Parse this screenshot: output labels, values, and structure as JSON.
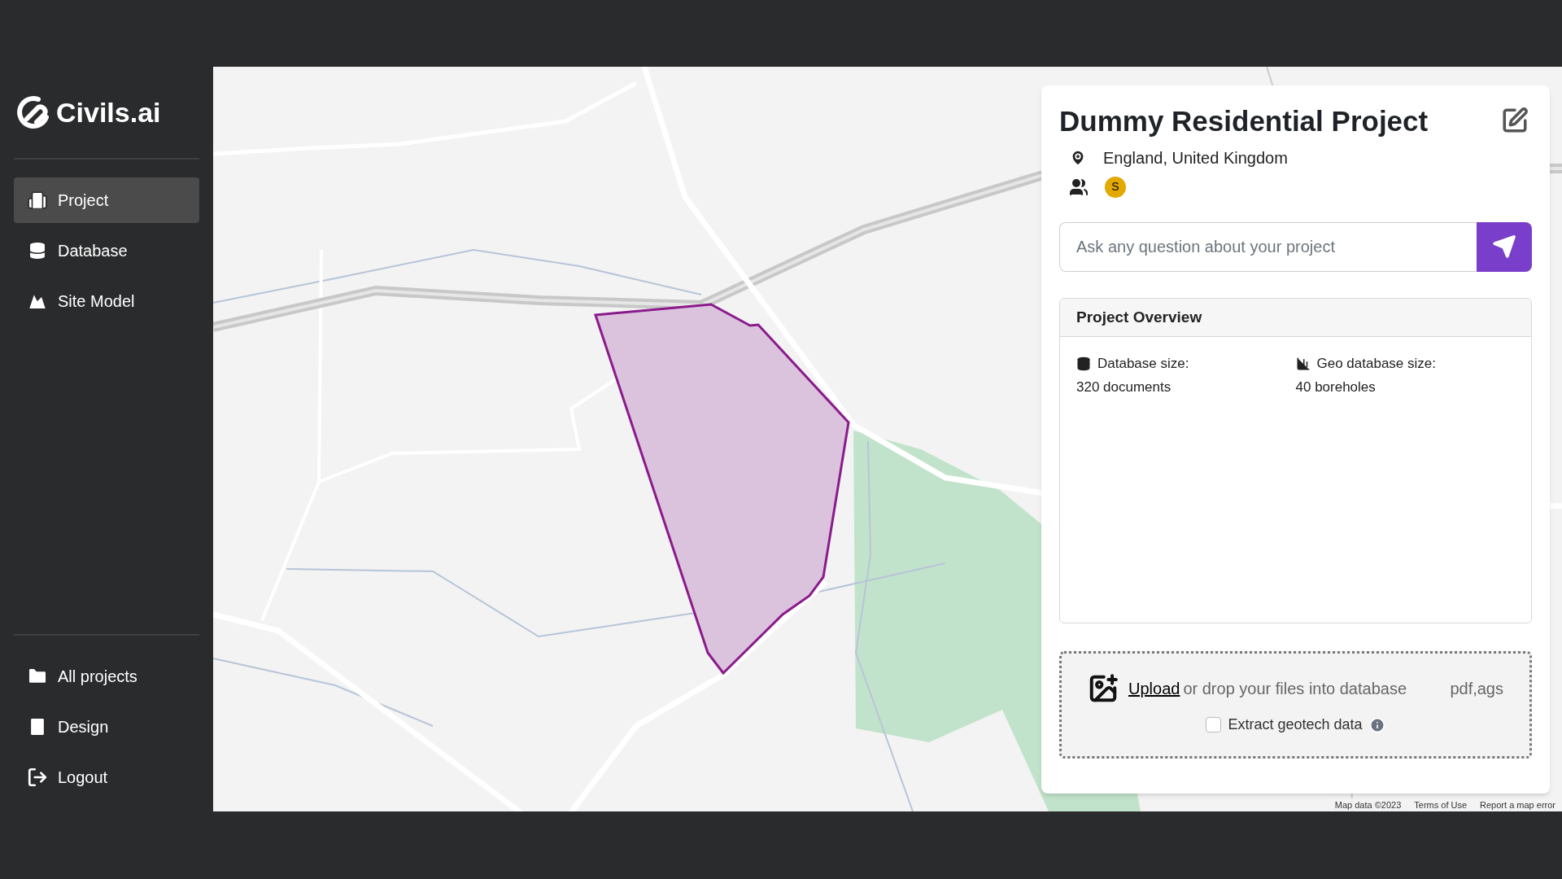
{
  "brand": {
    "name": "Civils.ai"
  },
  "sidebar": {
    "items": [
      {
        "label": "Project",
        "selected": true
      },
      {
        "label": "Database",
        "selected": false
      },
      {
        "label": "Site Model",
        "selected": false
      }
    ],
    "bottom_items": [
      {
        "label": "All projects"
      },
      {
        "label": "Design"
      },
      {
        "label": "Logout"
      }
    ]
  },
  "project": {
    "title": "Dummy Residential Project",
    "location": "England, United Kingdom",
    "members": [
      {
        "initial": "S",
        "color": "#e2a900"
      }
    ],
    "question": {
      "placeholder": "Ask any question about your project"
    },
    "overview": {
      "title": "Project Overview",
      "stats": [
        {
          "label": "Database size:",
          "value": "320 documents"
        },
        {
          "label": "Geo database size:",
          "value": "40 boreholes"
        }
      ]
    },
    "upload": {
      "link": "Upload",
      "text": "or drop your files into database",
      "formats": "pdf,ags",
      "extract": {
        "label": "Extract geotech data",
        "checked": false
      }
    }
  },
  "map": {
    "attribution": [
      "Map data ©2023",
      "Terms of Use",
      "Report a map error"
    ]
  }
}
